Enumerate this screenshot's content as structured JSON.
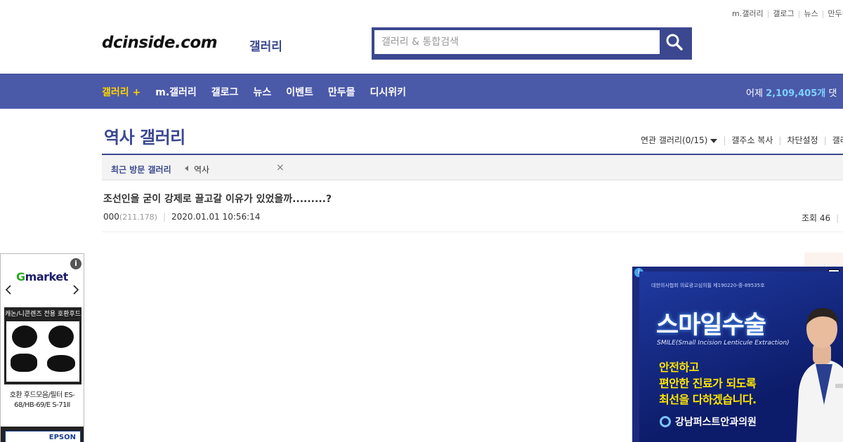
{
  "topnav": [
    "m.갤러리",
    "갤로그",
    "뉴스",
    "만두몰"
  ],
  "header": {
    "logo": "dcinside.com",
    "logo_sub": "갤러리",
    "search_placeholder": "갤러리 & 통합검색"
  },
  "gnb": {
    "items": [
      "갤러리 +",
      "m.갤러리",
      "갤로그",
      "뉴스",
      "이벤트",
      "만두몰",
      "디시위키"
    ],
    "stat_prefix": "어제",
    "stat_value": "2,109,405개",
    "stat_suffix": "댓"
  },
  "gallery": {
    "title": "역사 갤러리",
    "related": "연관 갤러리(0/15)",
    "copy_addr": "갤주소 복사",
    "block_settings": "차단설정",
    "more": "갤러"
  },
  "visited": {
    "label": "최근 방문 갤러리",
    "item": "역사",
    "close": "×"
  },
  "post": {
    "title": "조선인을 굳이 강제로 끌고갈 이유가 있었을까.........?",
    "author": "000",
    "ip": "(211.178)",
    "datetime": "2020.01.01 10:56:14",
    "views": "조회 46"
  },
  "left_ad": {
    "info": "i",
    "brand_g": "G",
    "brand_rest": "market",
    "product_header": "캐논/니콘렌즈 전용 호환후드",
    "product_name": "호환 후드모음/필터 ES-68/HB-69/E S-71II",
    "next_brand": "EPSON"
  },
  "right_ad": {
    "info": "i",
    "notice": "대한의사협회 의료광고심의필 제190220-중-89535호",
    "headline": "스마일수술",
    "sub": "SMILE(Small Incision Lenticule Extraction)",
    "copy1": "안전하고",
    "copy2": "편안한 진료가 되도록",
    "copy3": "최선을 다하겠습니다.",
    "clinic": "강남퍼스트안과의원"
  }
}
